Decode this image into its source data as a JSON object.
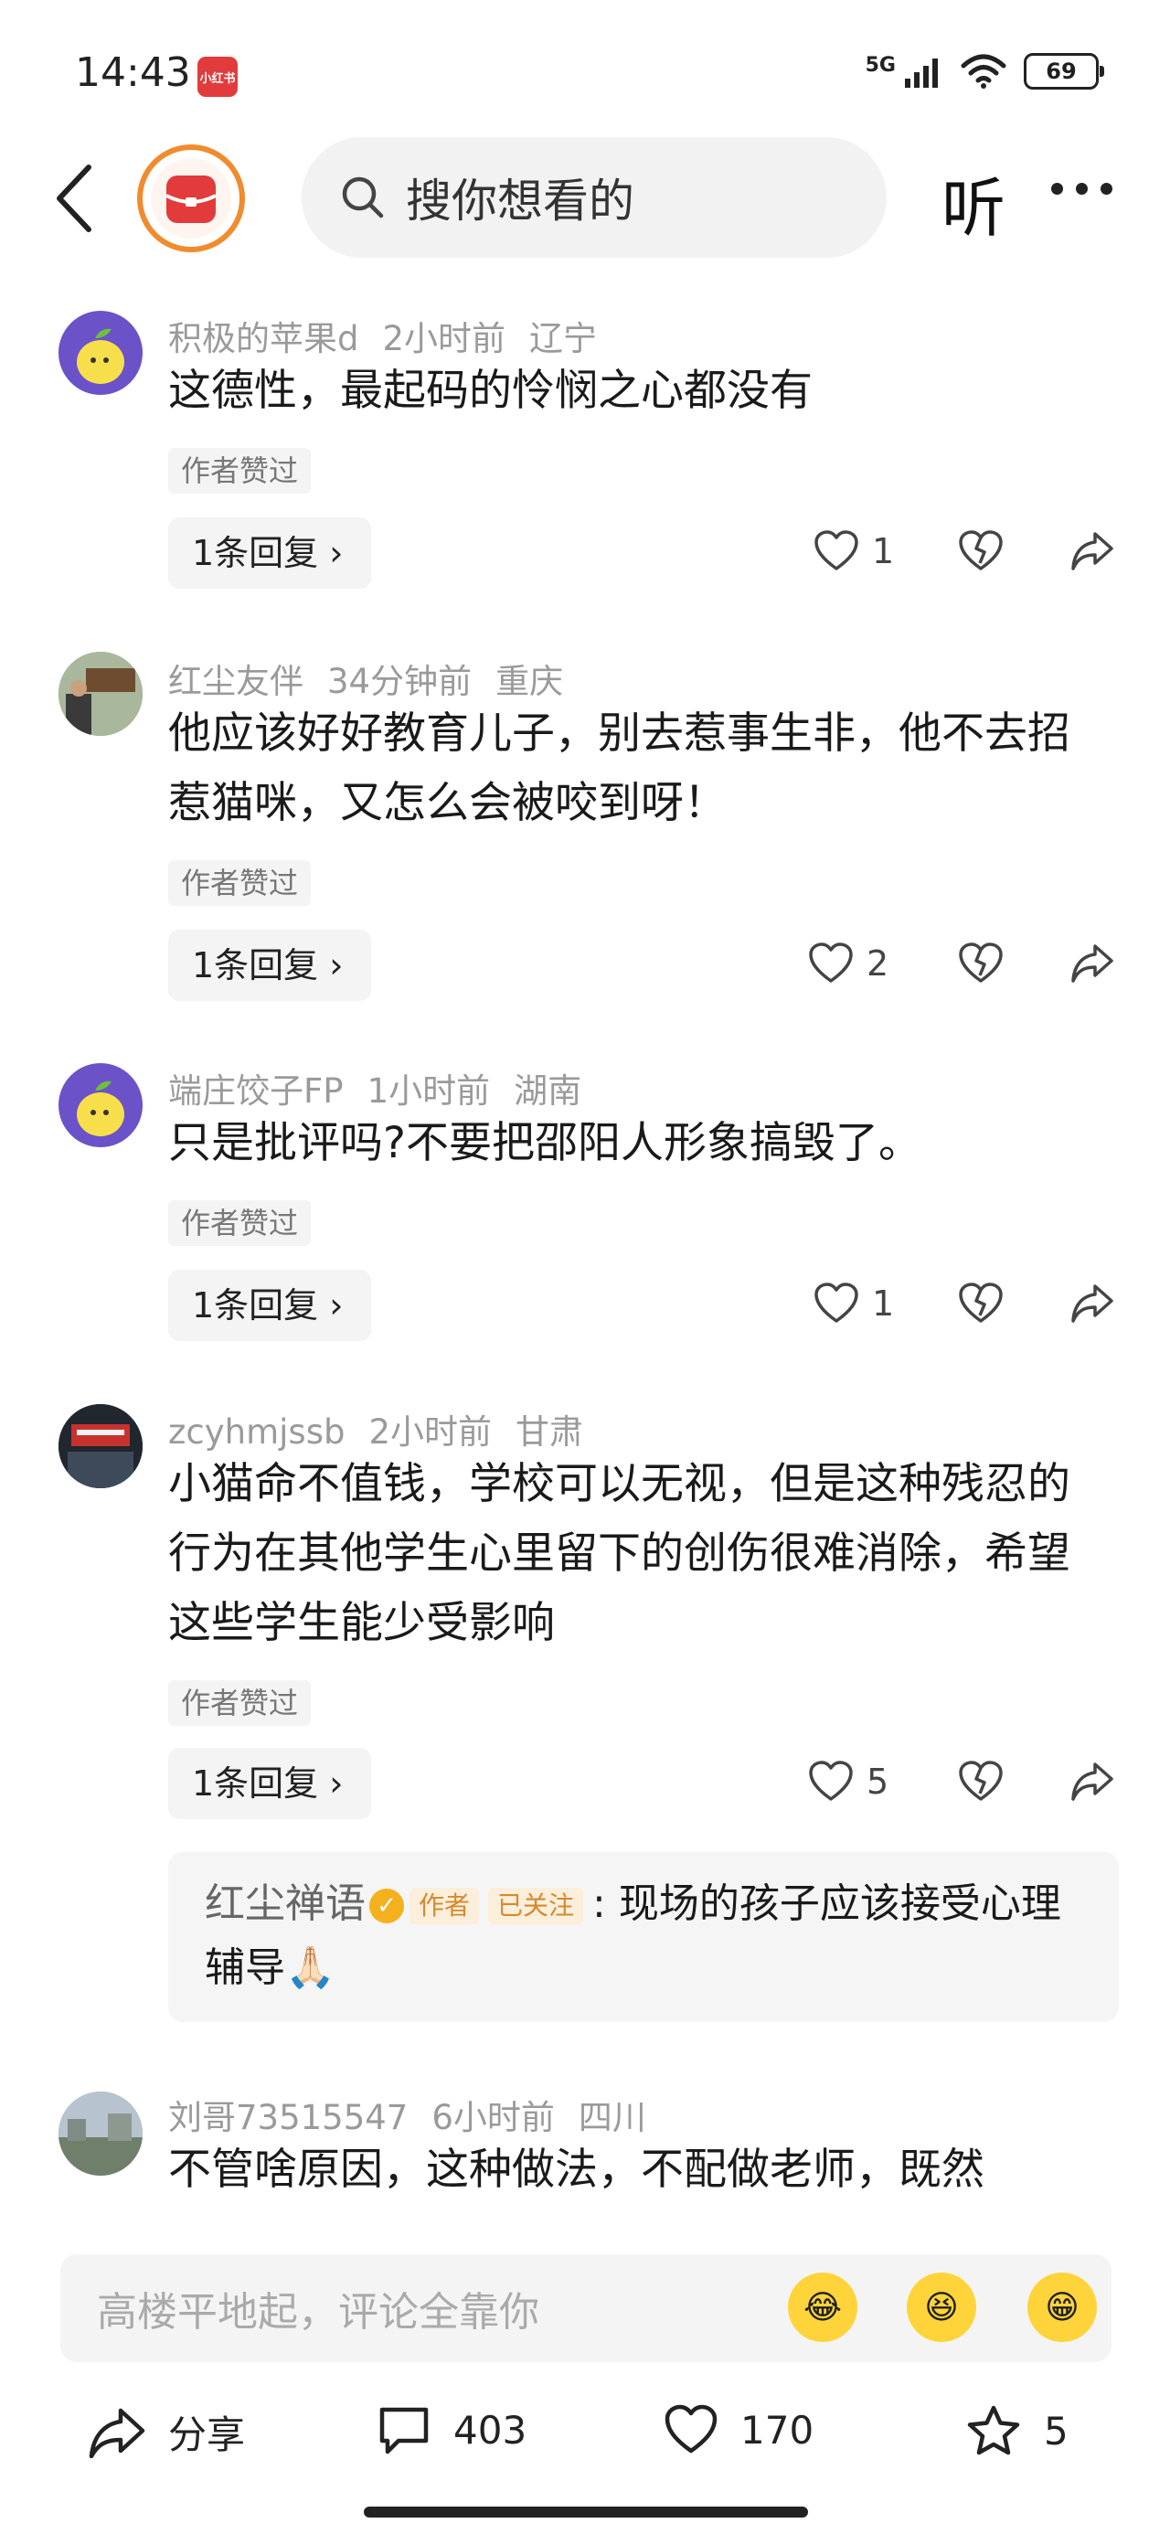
{
  "status_bar": {
    "time": "14:43",
    "app_badge": "小红书",
    "network": "5G",
    "battery": "69"
  },
  "nav": {
    "search_placeholder": "搜你想看的",
    "listen_label": "听"
  },
  "comments": [
    {
      "user": "积极的苹果d",
      "time": "2小时前",
      "location": "辽宁",
      "text": "这德性，最起码的怜悯之心都没有",
      "liked_tag": "作者赞过",
      "reply_label": "1条回复 ›",
      "likes": "1"
    },
    {
      "user": "红尘友伴",
      "time": "34分钟前",
      "location": "重庆",
      "text": "他应该好好教育儿子，别去惹事生非，他不去招惹猫咪，又怎么会被咬到呀！",
      "liked_tag": "作者赞过",
      "reply_label": "1条回复 ›",
      "likes": "2"
    },
    {
      "user": "端庄饺子FP",
      "time": "1小时前",
      "location": "湖南",
      "text": "只是批评吗?不要把邵阳人形象搞毁了。",
      "liked_tag": "作者赞过",
      "reply_label": "1条回复 ›",
      "likes": "1"
    },
    {
      "user": "zcyhmjssb",
      "time": "2小时前",
      "location": "甘肃",
      "text": "小猫命不值钱，学校可以无视，但是这种残忍的行为在其他学生心里留下的创伤很难消除，希望这些学生能少受影响",
      "liked_tag": "作者赞过",
      "reply_label": "1条回复 ›",
      "likes": "5",
      "author_reply": {
        "name": "红尘禅语",
        "role_tag": "作者",
        "follow_tag": "已关注",
        "text": ": 现场的孩子应该接受心理辅导🙏🏻"
      }
    },
    {
      "user": "刘哥73515547",
      "time": "6小时前",
      "location": "四川",
      "text": "不管啥原因，这种做法，不配做老师，既然"
    }
  ],
  "comment_input": {
    "placeholder": "高楼平地起，评论全靠你"
  },
  "bottom_bar": {
    "share_label": "分享",
    "comment_count": "403",
    "like_count": "170",
    "favorite_count": "5"
  },
  "colors": {
    "accent": "#e23b3b",
    "verify": "#f5b01d",
    "author_tag": "#d48a2f"
  }
}
